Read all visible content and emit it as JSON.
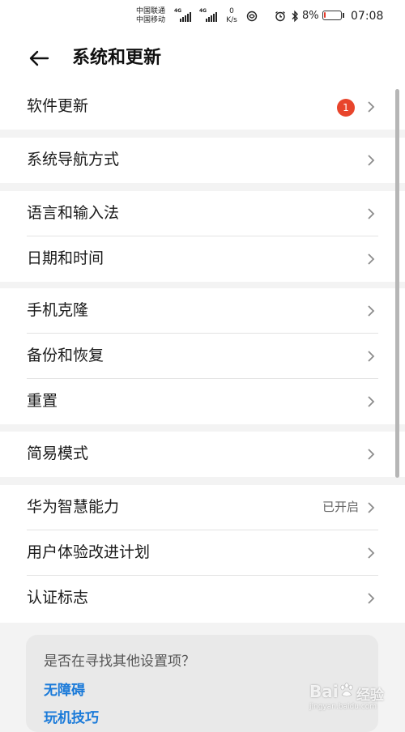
{
  "status_bar": {
    "carrier_1": "中国联通",
    "carrier_2": "中国移动",
    "network_1": "4G",
    "network_2": "4G",
    "speed_value": "0",
    "speed_unit": "K/s",
    "battery_percent": "8%",
    "battery_level": 0.08,
    "battery_color": "#e53a2a",
    "time": "07:08",
    "icons": [
      "signal-icon",
      "hd-icon",
      "alarm-icon",
      "bluetooth-icon",
      "battery-icon"
    ]
  },
  "header": {
    "back_icon": "back-arrow-icon",
    "title": "系统和更新"
  },
  "settings": {
    "software_update": {
      "label": "软件更新",
      "badge": "1",
      "badge_color": "#e8452c"
    },
    "navigation": {
      "label": "系统导航方式"
    },
    "language": {
      "label": "语言和输入法"
    },
    "datetime": {
      "label": "日期和时间"
    },
    "phone_clone": {
      "label": "手机克隆"
    },
    "backup": {
      "label": "备份和恢复"
    },
    "reset": {
      "label": "重置"
    },
    "simple_mode": {
      "label": "简易模式"
    },
    "huawei_ai": {
      "label": "华为智慧能力",
      "value": "已开启"
    },
    "ux_plan": {
      "label": "用户体验改进计划"
    },
    "certification": {
      "label": "认证标志"
    }
  },
  "suggest": {
    "question": "是否在寻找其他设置项？",
    "links": [
      "无障碍",
      "玩机技巧"
    ],
    "link_color": "#1a7ad9"
  },
  "watermark": {
    "brand": "Bai",
    "brand_suffix": "经验",
    "sub": "jingyan.baidu.com"
  }
}
